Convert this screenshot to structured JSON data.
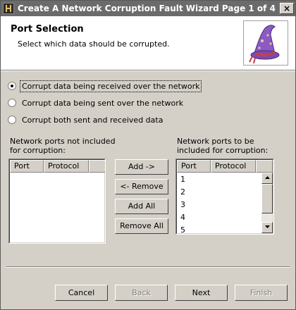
{
  "window": {
    "title": "Create A Network Corruption Fault Wizard Page 1 of 4",
    "close_glyph": "×"
  },
  "header": {
    "heading": "Port Selection",
    "subtitle": "Select which data should be corrupted.",
    "image_icon": "wizard-hat-icon"
  },
  "options": [
    {
      "label": "Corrupt data being received over the network",
      "selected": true
    },
    {
      "label": "Corrupt data being sent over the network",
      "selected": false
    },
    {
      "label": "Corrupt both sent and received data",
      "selected": false
    }
  ],
  "excluded": {
    "label_line1": "Network ports not included",
    "label_line2": "for corruption:",
    "columns": [
      "Port",
      "Protocol"
    ],
    "rows": []
  },
  "included": {
    "label_line1": "Network ports to be",
    "label_line2": "included for corruption:",
    "columns": [
      "Port",
      "Protocol"
    ],
    "rows": [
      "1",
      "2",
      "3",
      "4",
      "5"
    ]
  },
  "transfer_buttons": {
    "add": "Add ->",
    "remove": "<- Remove",
    "add_all": "Add All",
    "remove_all": "Remove All"
  },
  "nav_buttons": {
    "cancel": "Cancel",
    "back": "Back",
    "next": "Next",
    "finish": "Finish"
  },
  "colors": {
    "titlebar": "#6b6b6b",
    "face": "#d4d0c8",
    "hat": "#8a5bc4"
  }
}
